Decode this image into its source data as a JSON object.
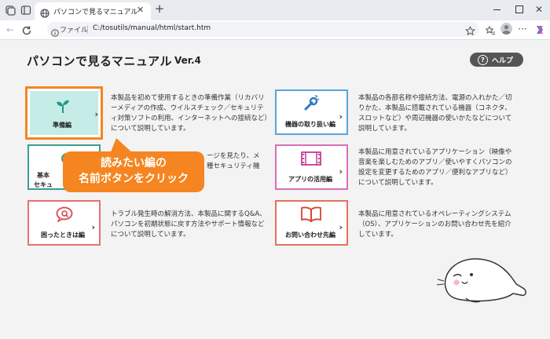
{
  "browser": {
    "tab_title": "パソコンで見るマニュアル",
    "new_tab_symbol": "+",
    "address_label": "ファイル",
    "url": "C:/tosutils/manual/html/start.htm"
  },
  "header": {
    "title": "パソコンで見るマニュアル",
    "version": "Ver.4",
    "help_label": "ヘルプ"
  },
  "callout": {
    "line1": "読みたい編の",
    "line2": "名前ボタンをクリック"
  },
  "sections": [
    {
      "label": "準備編",
      "color": "#f58520",
      "icon": "sprout-icon",
      "desc": "本製品を初めて使用するときの準備作業（リカバリーメディアの作成、ウイルスチェック／セキュリティ対策ソフトの利用、インターネットへの接続など）について説明しています。"
    },
    {
      "label": "機器の取り扱い編",
      "color": "#5aa6d8",
      "icon": "tools-icon",
      "desc": "本製品の各部名称や接続方法、電源の入れかた／切りかた、本製品に搭載されている機器（コネクタ、スロットなど）や周辺機器の使いかたなどについて説明しています。"
    },
    {
      "label": "基本",
      "label_line2": "セキュ",
      "color": "#3a9e92",
      "icon": "basic-icon",
      "desc_line1": "ージを見たり、メ",
      "desc_line2": "種セキュリティ機"
    },
    {
      "label": "アプリの活用編",
      "color": "#d86fb8",
      "icon": "film-icon",
      "desc": "本製品に用意されているアプリケーション（映像や音楽を楽しむためのアプリ／使いやすくパソコンの設定を変更するためのアプリ／便利なアプリなど）について説明しています。"
    },
    {
      "label": "困ったときは編",
      "color": "#e76f73",
      "icon": "question-icon",
      "desc": "トラブル発生時の解消方法、本製品に関するQ&A、パソコンを初期状態に戻す方法やサポート情報などについて説明しています。"
    },
    {
      "label": "お問い合わせ先編",
      "color": "#e2725a",
      "icon": "book-icon",
      "desc": "本製品に用意されているオペレーティングシステム（OS）、アプリケーションのお問い合わせ先を紹介しています。"
    }
  ],
  "card_arrow": "›"
}
